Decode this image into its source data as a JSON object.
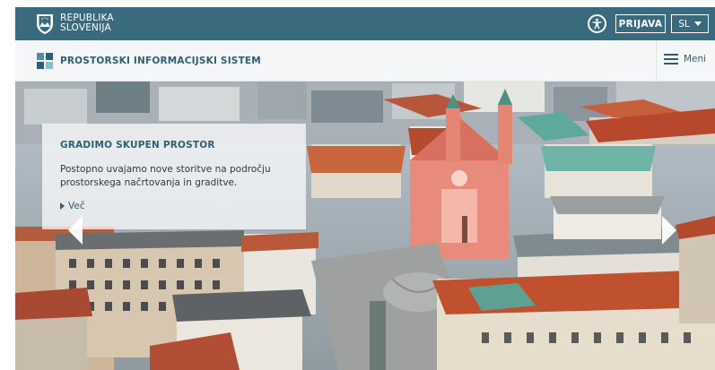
{
  "gov": {
    "name_line1": "REPUBLIKA",
    "name_line2": "SLOVENIJA",
    "login_label": "PRIJAVA",
    "language": "SL",
    "accessibility_icon": "accessibility-icon",
    "colors": {
      "bar": "#3a6a7d"
    }
  },
  "app": {
    "title": "PROSTORSKI INFORMACIJSKI SISTEM",
    "menu_label": "Meni",
    "colors": {
      "accent": "#2f5f72",
      "bar": "#f5f6f7"
    }
  },
  "hero": {
    "card": {
      "title": "GRADIMO SKUPEN PROSTOR",
      "text": "Postopno uvajamo nove storitve na področju prostorskega načrtovanja in graditve.",
      "more_label": "Več"
    },
    "image": "aerial photo of Ljubljana old town with pink church"
  }
}
